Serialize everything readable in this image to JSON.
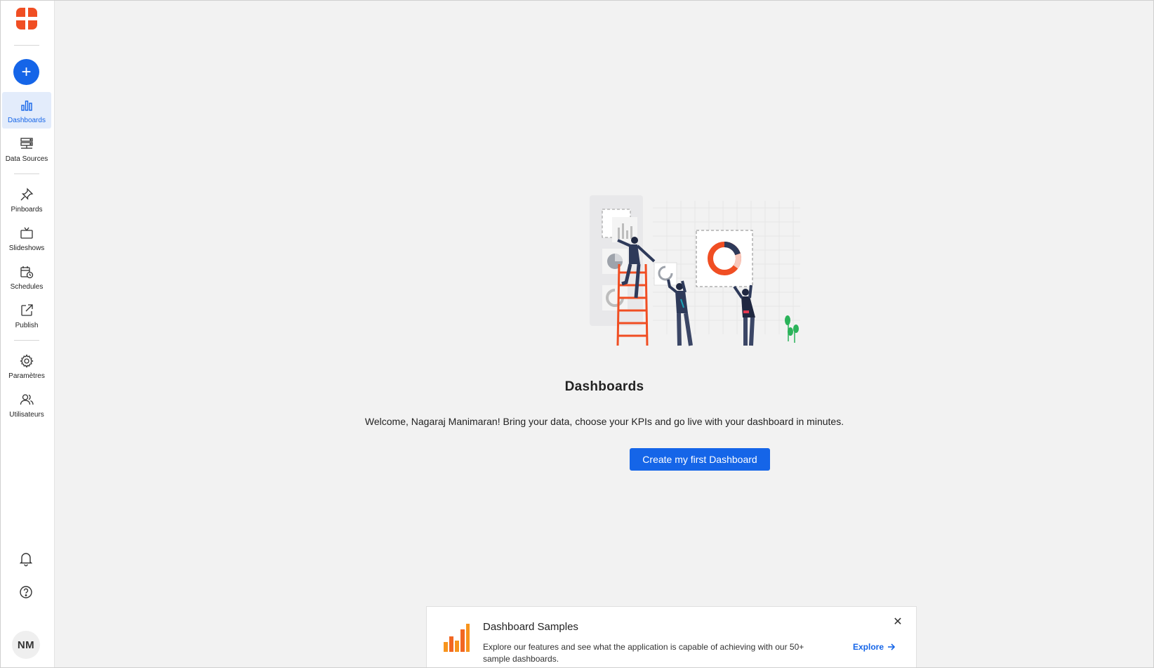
{
  "colors": {
    "brand_orange": "#f04e23",
    "primary_blue": "#1565e8"
  },
  "sidebar": {
    "logo_icon": "brand-logo",
    "add_icon": "plus-icon",
    "add_label": "+",
    "items": [
      {
        "label": "Dashboards",
        "icon": "bar-chart-icon",
        "active": true
      },
      {
        "label": "Data Sources",
        "icon": "database-icon"
      },
      {
        "label": "Pinboards",
        "icon": "pin-icon"
      },
      {
        "label": "Slideshows",
        "icon": "tv-icon"
      },
      {
        "label": "Schedules",
        "icon": "calendar-clock-icon"
      },
      {
        "label": "Publish",
        "icon": "share-icon"
      },
      {
        "label": "Paramètres",
        "icon": "gear-icon"
      },
      {
        "label": "Utilisateurs",
        "icon": "users-icon"
      }
    ],
    "bottom": {
      "notifications_icon": "bell-icon",
      "help_icon": "help-icon",
      "avatar_initials": "NM"
    }
  },
  "main": {
    "title": "Dashboards",
    "welcome": "Welcome, Nagaraj Manimaran! Bring your data, choose your KPIs and go live with your dashboard in minutes.",
    "cta_label": "Create my first Dashboard"
  },
  "samples_card": {
    "title": "Dashboard Samples",
    "description": "Explore our features and see what the application is capable of achieving with our 50+ sample dashboards.",
    "explore_label": "Explore",
    "close_icon": "close-icon"
  }
}
